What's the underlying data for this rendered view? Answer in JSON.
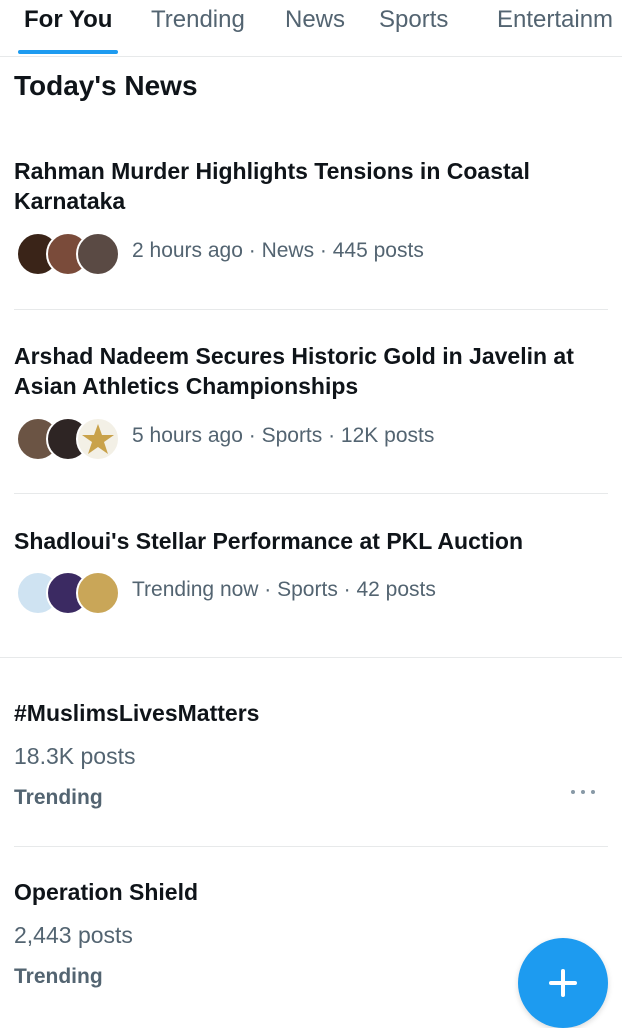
{
  "tabs": [
    {
      "label": "For You",
      "active": true
    },
    {
      "label": "Trending"
    },
    {
      "label": "News"
    },
    {
      "label": "Sports"
    },
    {
      "label": "Entertainm"
    }
  ],
  "section_title": "Today's News",
  "news": [
    {
      "title": "Rahman Murder Highlights Tensions in Coastal Karnataka",
      "meta": "2 hours ago · News · 445 posts",
      "avatar_colors": [
        "#3a2418",
        "#7a4b3a",
        "#5a4a44"
      ]
    },
    {
      "title": "Arshad Nadeem Secures Historic Gold in Javelin at Asian Athletics Championships",
      "meta": "5 hours ago · Sports · 12K posts",
      "avatar_colors": [
        "#6b5444",
        "#2e2524",
        "#f3f0e6"
      ]
    },
    {
      "title": "Shadloui's Stellar Performance at PKL Auction",
      "meta": "Trending now · Sports · 42 posts",
      "avatar_colors": [
        "#cfe3f2",
        "#3b2a62",
        "#c9a658"
      ]
    }
  ],
  "trends": [
    {
      "name": "#MuslimsLivesMatters",
      "count": "18.3K posts",
      "label": "Trending"
    },
    {
      "name": "Operation Shield",
      "count": "2,443 posts",
      "label": "Trending"
    }
  ],
  "colors": {
    "accent": "#1d9bf0",
    "text_primary": "#0f1419",
    "text_secondary": "#536471",
    "divider": "#e7e9ea"
  },
  "icons": {
    "more": "more-dots-icon",
    "compose": "plus-icon"
  }
}
